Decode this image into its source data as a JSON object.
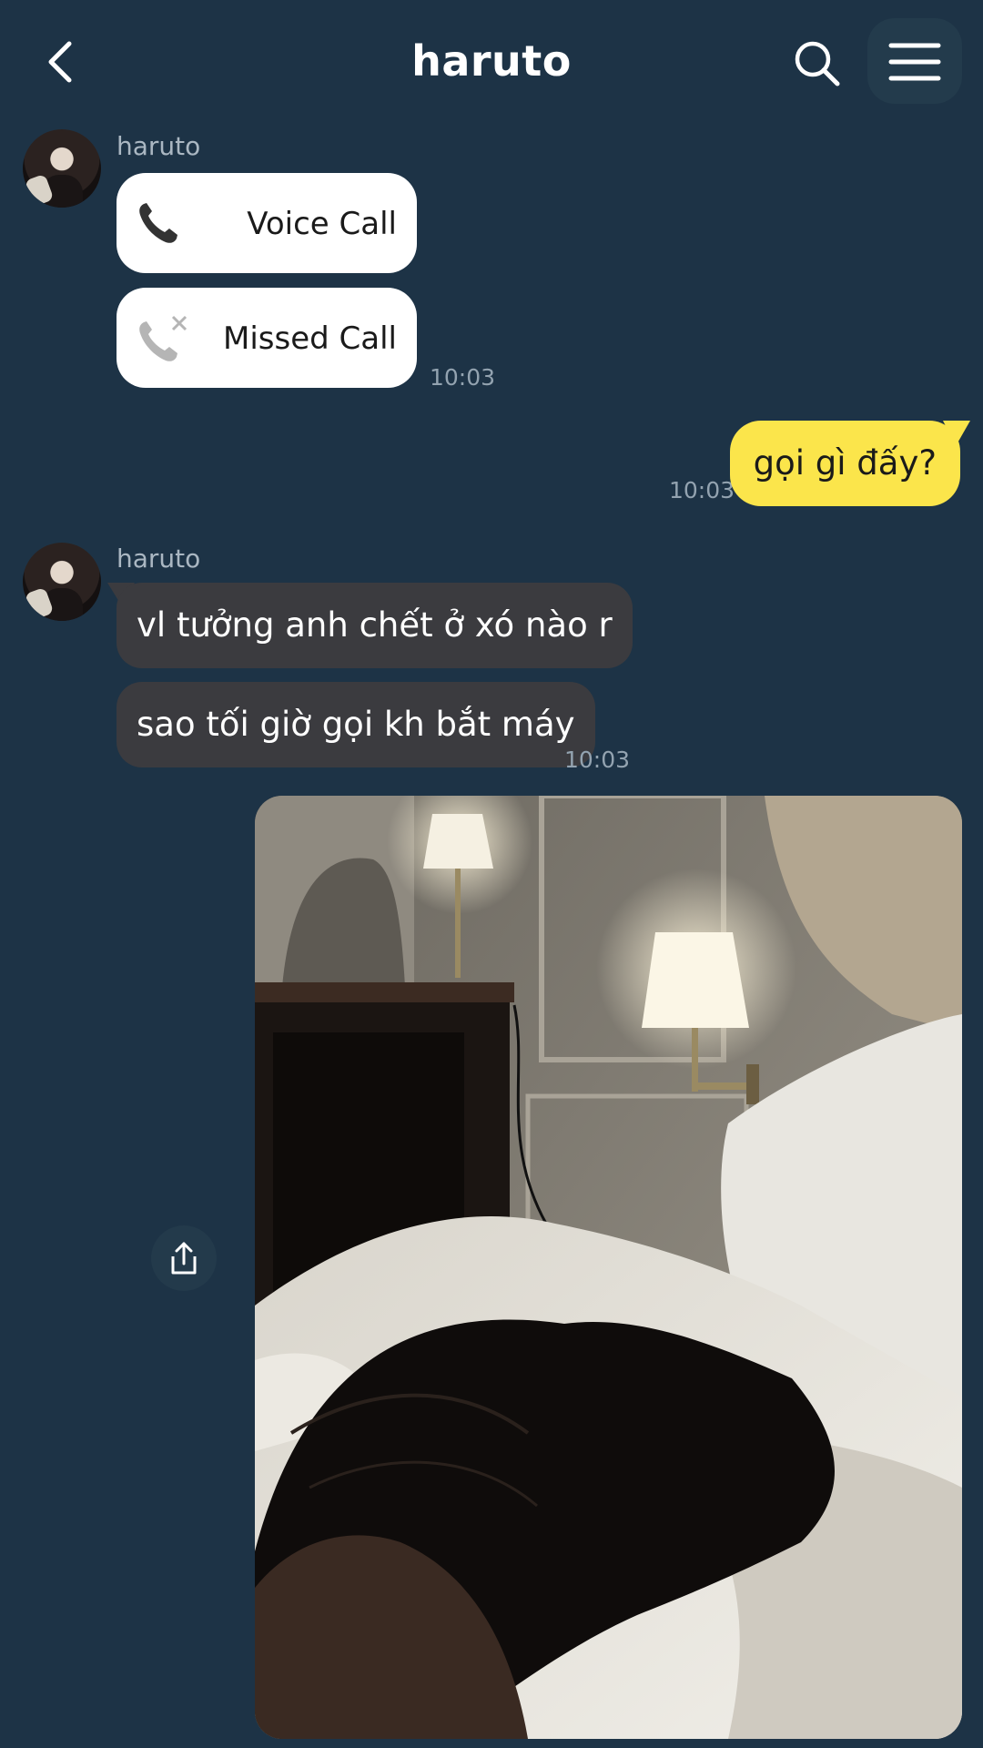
{
  "header": {
    "title": "haruto"
  },
  "messages": {
    "first_group": {
      "sender": "haruto",
      "voice_call_label": "Voice Call",
      "missed_call_label": "Missed Call",
      "time": "10:03"
    },
    "outgoing": {
      "text": "gọi gì đấy?",
      "time": "10:03"
    },
    "second_group": {
      "sender": "haruto",
      "line1": "vl tưởng anh chết ở xó nào r",
      "line2": "sao tối giờ gọi kh bắt máy",
      "time": "10:03"
    }
  },
  "colors": {
    "background": "#1d3346",
    "incoming_bubble": "#3b3b3f",
    "outgoing_bubble": "#fbe54b",
    "call_bubble": "#ffffff"
  },
  "icons": {
    "back": "chevron-left-icon",
    "search": "search-icon",
    "menu": "menu-icon",
    "voice_call": "phone-icon",
    "missed_call": "missed-call-icon",
    "share": "share-icon"
  }
}
